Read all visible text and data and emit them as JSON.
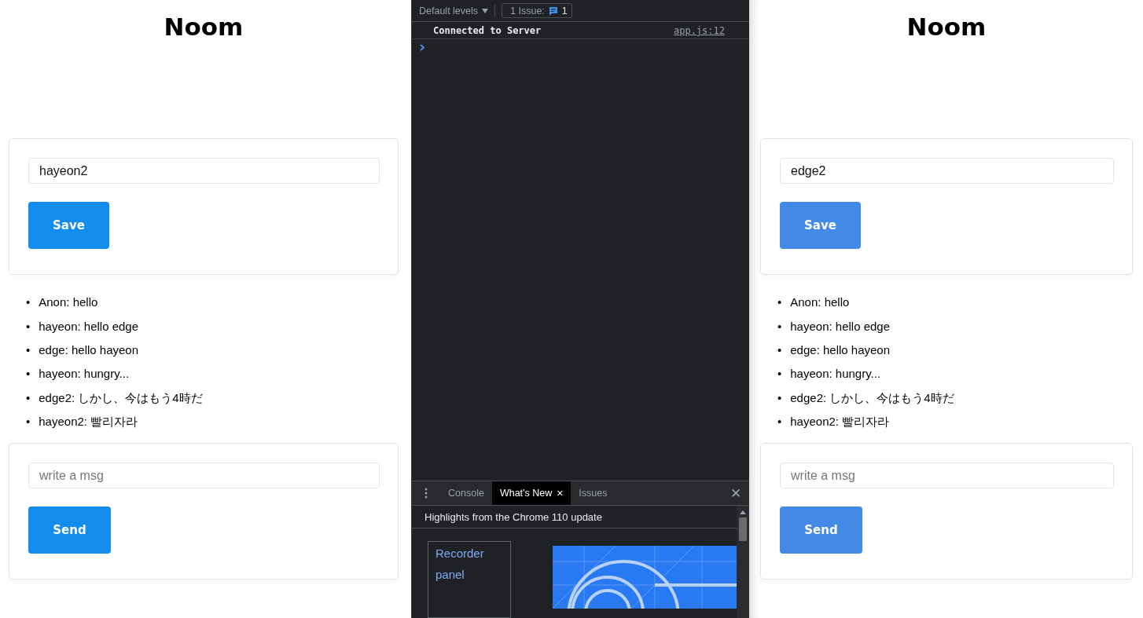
{
  "pages": [
    {
      "title": "Noom",
      "color": "#128ced",
      "bullet": "•",
      "name_field": {
        "value": "hayeon2"
      },
      "save_button": "Save",
      "messages": [
        "Anon: hello",
        "hayeon: hello edge",
        "edge: hello hayeon",
        "hayeon: hungry...",
        "edge2: しかし、今はもう4時だ",
        "hayeon2: 빨리자라"
      ],
      "message_field": {
        "placeholder": "write a msg"
      },
      "send_button": "Send"
    },
    {
      "title": "Noom",
      "color": "#428ae6",
      "bullet": "•",
      "name_field": {
        "value": "edge2"
      },
      "save_button": "Save",
      "messages": [
        "Anon: hello",
        "hayeon: hello edge",
        "edge: hello hayeon",
        "hayeon: hungry...",
        "edge2: しかし、今はもう4時だ",
        "hayeon2: 빨리자라"
      ],
      "message_field": {
        "placeholder": "write a msg"
      },
      "send_button": "Send"
    }
  ],
  "devtools": {
    "levels": "Default levels",
    "issues_label": "1 Issue:",
    "issues_count": "1",
    "console_messages": [
      {
        "text": "Connected to Server",
        "source": "app.js:12"
      }
    ],
    "drawer_tabs": [
      {
        "label": "Console",
        "selected": false,
        "closable": false
      },
      {
        "label": "What's New",
        "selected": true,
        "closable": true
      },
      {
        "label": "Issues",
        "selected": false,
        "closable": false
      }
    ],
    "close": "✕",
    "tab_close": "×",
    "whats_new": {
      "header": "Highlights from the Chrome 110 update",
      "links": [
        "Recorder",
        "panel"
      ],
      "image": {
        "kind": "picture"
      }
    }
  }
}
